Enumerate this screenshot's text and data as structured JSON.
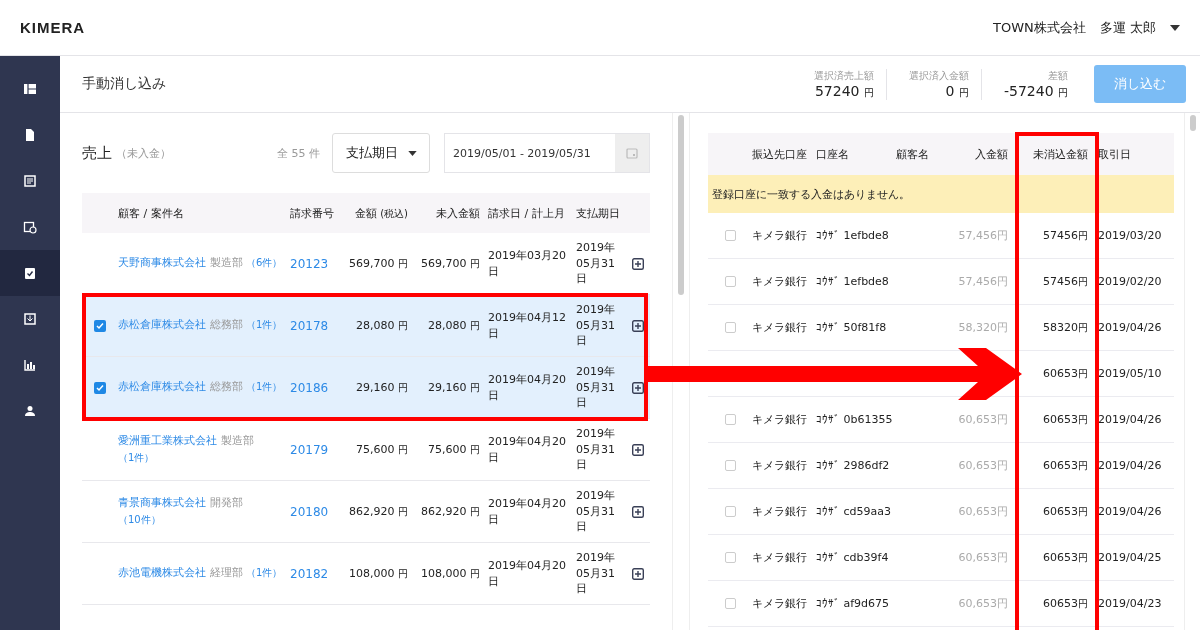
{
  "header": {
    "logo": "KIMERA",
    "company": "TOWN株式会社",
    "user": "多運 太郎"
  },
  "sidebar": {
    "items": [
      {
        "selected": false
      },
      {
        "selected": false
      },
      {
        "selected": false
      },
      {
        "selected": false
      },
      {
        "selected": true
      },
      {
        "selected": false
      },
      {
        "selected": false
      },
      {
        "selected": false
      }
    ]
  },
  "topbar": {
    "title": "手動消し込み",
    "stats": [
      {
        "label": "選択済売上額",
        "value": "57240",
        "unit": "円"
      },
      {
        "label": "選択済入金額",
        "value": "0",
        "unit": "円"
      },
      {
        "label": "差額",
        "value": "-57240",
        "unit": "円"
      }
    ],
    "action": {
      "label": "消し込む",
      "disabled": true
    }
  },
  "sales": {
    "title": "売上",
    "subtitle": "（未入金）",
    "count": "全 55 件",
    "filter": "支払期日",
    "date_range": "2019/05/01 - 2019/05/31",
    "columns": [
      {
        "label": "顧客 / 案件名"
      },
      {
        "label": "請求番号"
      },
      {
        "label": "金額",
        "note": "(税込)"
      },
      {
        "label": "未入金額"
      },
      {
        "label": "請求日 / 計上月"
      },
      {
        "label": "支払期日"
      }
    ],
    "rows": [
      {
        "selected": false,
        "customer": "天野商事株式会社",
        "department": "製造部",
        "cases": "（6件）",
        "invoice": "20123",
        "amount": "569,700",
        "amount_unit": "円",
        "unpaid": "569,700",
        "unpaid_unit": "円",
        "issue_date": "2019年03月20日",
        "due_date": "2019年05月31日"
      },
      {
        "selected": true,
        "customer": "赤松倉庫株式会社",
        "department": "総務部",
        "cases": "（1件）",
        "invoice": "20178",
        "amount": "28,080",
        "amount_unit": "円",
        "unpaid": "28,080",
        "unpaid_unit": "円",
        "issue_date": "2019年04月12日",
        "due_date": "2019年05月31日"
      },
      {
        "selected": true,
        "customer": "赤松倉庫株式会社",
        "department": "総務部",
        "cases": "（1件）",
        "invoice": "20186",
        "amount": "29,160",
        "amount_unit": "円",
        "unpaid": "29,160",
        "unpaid_unit": "円",
        "issue_date": "2019年04月20日",
        "due_date": "2019年05月31日"
      },
      {
        "selected": false,
        "customer": "愛洲重工業株式会社",
        "department": "製造部",
        "cases": "（1件）",
        "invoice": "20179",
        "amount": "75,600",
        "amount_unit": "円",
        "unpaid": "75,600",
        "unpaid_unit": "円",
        "issue_date": "2019年04月20日",
        "due_date": "2019年05月31日"
      },
      {
        "selected": false,
        "customer": "青景商事株式会社",
        "department": "開発部",
        "cases": "（10件）",
        "invoice": "20180",
        "amount": "862,920",
        "amount_unit": "円",
        "unpaid": "862,920",
        "unpaid_unit": "円",
        "issue_date": "2019年04月20日",
        "due_date": "2019年05月31日"
      },
      {
        "selected": false,
        "customer": "赤池電機株式会社",
        "department": "経理部",
        "cases": "（1件）",
        "invoice": "20182",
        "amount": "108,000",
        "amount_unit": "円",
        "unpaid": "108,000",
        "unpaid_unit": "円",
        "issue_date": "2019年04月20日",
        "due_date": "2019年05月31日"
      }
    ]
  },
  "deposits": {
    "columns": [
      "振込先口座",
      "口座名",
      "顧客名",
      "入金額",
      "未消込金額",
      "取引日"
    ],
    "notice": "登録口座に一致する入金はありません。",
    "rows": [
      {
        "kind": "row",
        "checked": false,
        "bank": "キメラ銀行",
        "account": "ｺｳｻﾞ 1efbde8",
        "amount": "57,456円",
        "unpaid": "57456",
        "unit": "円",
        "date": "2019/03/20"
      },
      {
        "kind": "row",
        "checked": false,
        "bank": "キメラ銀行",
        "account": "ｺｳｻﾞ 1efbde8",
        "amount": "57,456円",
        "unpaid": "57456",
        "unit": "円",
        "date": "2019/02/20"
      },
      {
        "kind": "row",
        "checked": false,
        "bank": "キメラ銀行",
        "account": "ｺｳｻﾞ 50f81f8",
        "amount": "58,320円",
        "unpaid": "58320",
        "unit": "円",
        "date": "2019/04/26"
      },
      {
        "kind": "covered",
        "unpaid": "60653",
        "unit": "円",
        "date": "2019/05/10"
      },
      {
        "kind": "row",
        "checked": false,
        "bank": "キメラ銀行",
        "account": "ｺｳｻﾞ 0b61355",
        "amount": "60,653円",
        "unpaid": "60653",
        "unit": "円",
        "date": "2019/04/26"
      },
      {
        "kind": "row",
        "checked": false,
        "bank": "キメラ銀行",
        "account": "ｺｳｻﾞ 2986df2",
        "amount": "60,653円",
        "unpaid": "60653",
        "unit": "円",
        "date": "2019/04/26"
      },
      {
        "kind": "row",
        "checked": false,
        "bank": "キメラ銀行",
        "account": "ｺｳｻﾞ cd59aa3",
        "amount": "60,653円",
        "unpaid": "60653",
        "unit": "円",
        "date": "2019/04/26"
      },
      {
        "kind": "row",
        "checked": false,
        "bank": "キメラ銀行",
        "account": "ｺｳｻﾞ cdb39f4",
        "amount": "60,653円",
        "unpaid": "60653",
        "unit": "円",
        "date": "2019/04/25"
      },
      {
        "kind": "row",
        "checked": false,
        "bank": "キメラ銀行",
        "account": "ｺｳｻﾞ af9d675",
        "amount": "60,653円",
        "unpaid": "60653",
        "unit": "円",
        "date": "2019/04/23"
      }
    ]
  }
}
